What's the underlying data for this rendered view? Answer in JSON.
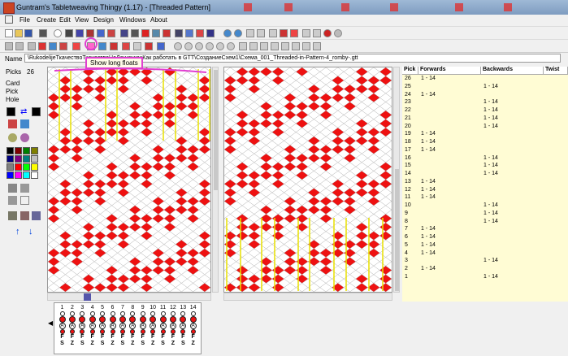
{
  "window": {
    "title": "Guntram's Tabletweaving Thingy (1.17) - [Threaded Pattern]"
  },
  "menu": [
    "File",
    "Create",
    "Edit",
    "View",
    "Design",
    "Windows",
    "About"
  ],
  "tooltip": "Show long floats",
  "name_bar": {
    "label": "Name",
    "value": "\\RukodelijeТкачествоТкачествоНаДощечкахКак работать в GTT\\СозданиеСхем1\\Схема_001_Threaded-in-Pattern-4_romby-.gtt"
  },
  "left_panel": {
    "picks_label": "Picks",
    "picks_value": "26",
    "card_label": "Card",
    "pick_label": "Pick",
    "hole_label": "Hole"
  },
  "colors": {
    "red": "#ee1111",
    "white": "#ffffff",
    "highlight": "#e03fd0",
    "table_bg": "#fffcd4"
  },
  "palette": [
    "#000000",
    "#7f0000",
    "#007f00",
    "#7f7f00",
    "#00007f",
    "#7f007f",
    "#007f7f",
    "#c0c0c0",
    "#808080",
    "#ff0000",
    "#00ff00",
    "#ffff00",
    "#0000ff",
    "#ff00ff",
    "#00ffff",
    "#ffffff"
  ],
  "table": {
    "headers": [
      "Pick",
      "Forwards",
      "Backwards",
      "Twist"
    ],
    "rows": [
      {
        "pick": "26",
        "forwards": "1 - 14",
        "backwards": ""
      },
      {
        "pick": "25",
        "forwards": "",
        "backwards": "1 - 14"
      },
      {
        "pick": "24",
        "forwards": "1 - 14",
        "backwards": ""
      },
      {
        "pick": "23",
        "forwards": "",
        "backwards": "1 - 14"
      },
      {
        "pick": "22",
        "forwards": "",
        "backwards": "1 - 14"
      },
      {
        "pick": "21",
        "forwards": "",
        "backwards": "1 - 14"
      },
      {
        "pick": "20",
        "forwards": "",
        "backwards": "1 - 14"
      },
      {
        "pick": "19",
        "forwards": "1 - 14",
        "backwards": ""
      },
      {
        "pick": "18",
        "forwards": "1 - 14",
        "backwards": ""
      },
      {
        "pick": "17",
        "forwards": "1 - 14",
        "backwards": ""
      },
      {
        "pick": "16",
        "forwards": "",
        "backwards": "1 - 14"
      },
      {
        "pick": "15",
        "forwards": "",
        "backwards": "1 - 14"
      },
      {
        "pick": "14",
        "forwards": "",
        "backwards": "1 - 14"
      },
      {
        "pick": "13",
        "forwards": "1 - 14",
        "backwards": ""
      },
      {
        "pick": "12",
        "forwards": "1 - 14",
        "backwards": ""
      },
      {
        "pick": "11",
        "forwards": "1 - 14",
        "backwards": ""
      },
      {
        "pick": "10",
        "forwards": "",
        "backwards": "1 - 14"
      },
      {
        "pick": "9",
        "forwards": "",
        "backwards": "1 - 14"
      },
      {
        "pick": "8",
        "forwards": "",
        "backwards": "1 - 14"
      },
      {
        "pick": "7",
        "forwards": "1 - 14",
        "backwards": ""
      },
      {
        "pick": "6",
        "forwards": "1 - 14",
        "backwards": ""
      },
      {
        "pick": "5",
        "forwards": "1 - 14",
        "backwards": ""
      },
      {
        "pick": "4",
        "forwards": "1 - 14",
        "backwards": ""
      },
      {
        "pick": "3",
        "forwards": "",
        "backwards": "1 - 14"
      },
      {
        "pick": "2",
        "forwards": "1 - 14",
        "backwards": ""
      },
      {
        "pick": "1",
        "forwards": "",
        "backwards": "1 - 14"
      }
    ]
  },
  "threading": {
    "cards": [
      "1",
      "2",
      "3",
      "4",
      "5",
      "6",
      "7",
      "8",
      "9",
      "10",
      "11",
      "12",
      "13",
      "14"
    ],
    "holes": [
      "A",
      "A",
      "A",
      "A",
      "A",
      "A",
      "A",
      "A",
      "A",
      "A",
      "A",
      "A",
      "A",
      "A"
    ],
    "turn_labels": [
      "F",
      "F",
      "F",
      "F",
      "F",
      "F",
      "F",
      "F",
      "F",
      "F",
      "F",
      "F",
      "F",
      "F"
    ],
    "thread_labels": [
      "S",
      "Z",
      "S",
      "Z",
      "S",
      "Z",
      "S",
      "Z",
      "S",
      "Z",
      "S",
      "Z",
      "S",
      "Z"
    ]
  }
}
